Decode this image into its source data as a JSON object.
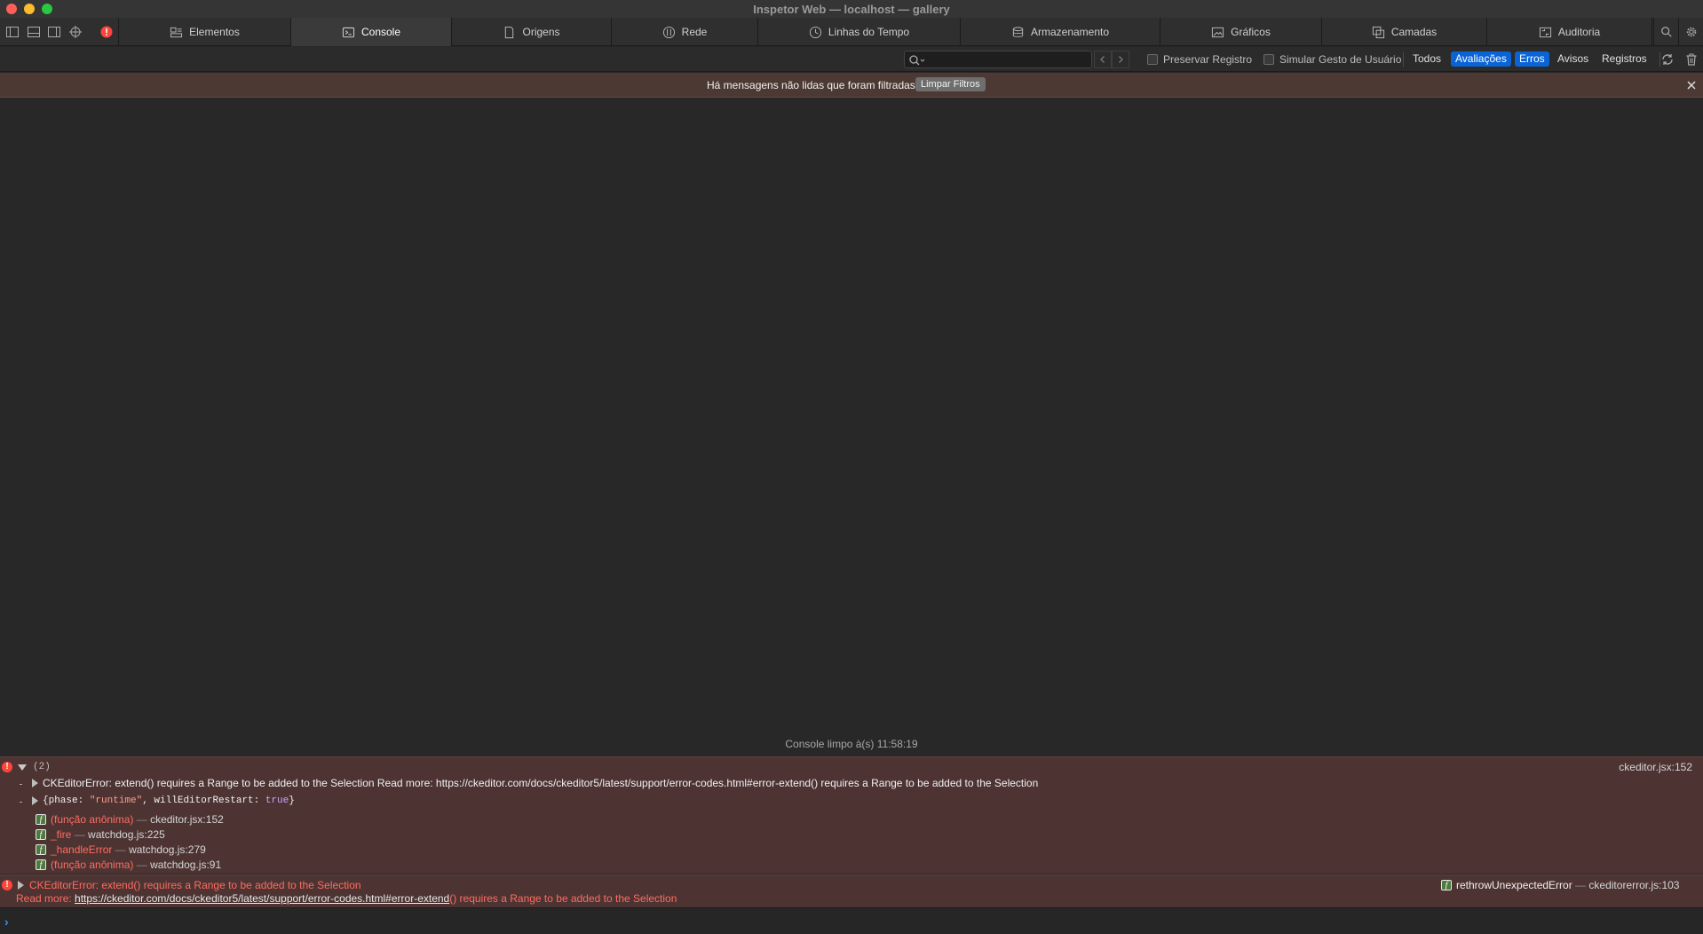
{
  "window": {
    "title": "Inspetor Web — localhost — gallery"
  },
  "tabs": [
    {
      "label": "Elementos",
      "icon": "elements-icon"
    },
    {
      "label": "Console",
      "icon": "console-icon",
      "active": true
    },
    {
      "label": "Origens",
      "icon": "document-icon"
    },
    {
      "label": "Rede",
      "icon": "network-icon"
    },
    {
      "label": "Linhas do Tempo",
      "icon": "clock-icon"
    },
    {
      "label": "Armazenamento",
      "icon": "database-icon"
    },
    {
      "label": "Gráficos",
      "icon": "image-icon"
    },
    {
      "label": "Camadas",
      "icon": "layers-icon"
    },
    {
      "label": "Auditoria",
      "icon": "audit-icon"
    }
  ],
  "filterbar": {
    "search_value": "",
    "preserve_log": "Preservar Registro",
    "simulate_gesture": "Simular Gesto de Usuário",
    "levels": [
      {
        "label": "Todos",
        "active": false
      },
      {
        "label": "Avaliações",
        "active": true
      },
      {
        "label": "Erros",
        "active": true
      },
      {
        "label": "Avisos",
        "active": false
      },
      {
        "label": "Registros",
        "active": false
      }
    ]
  },
  "banner": {
    "text": "Há mensagens não lidas que foram filtradas",
    "button": "Limpar Filtros"
  },
  "console": {
    "cleared": "Console limpo à(s) 11:58:19",
    "group": {
      "count": "(2)",
      "source": "ckeditor.jsx:152",
      "message": "CKEditorError: extend() requires a Range to be added to the Selection Read more: https://ckeditor.com/docs/ckeditor5/latest/support/error-codes.html#error-extend() requires a Range to be added to the Selection",
      "object_prefix": "{phase: ",
      "object_phase": "\"runtime\"",
      "object_mid": ", willEditorRestart: ",
      "object_restart": "true",
      "object_suffix": "}",
      "frames": [
        {
          "fn": "(função anônima)",
          "sep": "—",
          "loc": "ckeditor.jsx:152"
        },
        {
          "fn": "_fire",
          "sep": "—",
          "loc": "watchdog.js:225"
        },
        {
          "fn": "_handleError",
          "sep": "—",
          "loc": "watchdog.js:279"
        },
        {
          "fn": "(função anônima)",
          "sep": "—",
          "loc": "watchdog.js:91"
        }
      ]
    },
    "error2": {
      "message": "CKEditorError: extend() requires a Range to be added to the Selection",
      "readmore_prefix": "Read more: ",
      "link": "https://ckeditor.com/docs/ckeditor5/latest/support/error-codes.html#error-extend",
      "readmore_suffix": "() requires a Range to be added to the Selection",
      "frame_fn": "rethrowUnexpectedError",
      "frame_sep": "—",
      "frame_loc": "ckeditorerror.js:103"
    },
    "prompt_value": ""
  },
  "colors": {
    "error_bg": "#4d3433",
    "banner_bg": "#4d3933",
    "accent": "#0a64d6",
    "error_text": "#ff6b5e"
  }
}
